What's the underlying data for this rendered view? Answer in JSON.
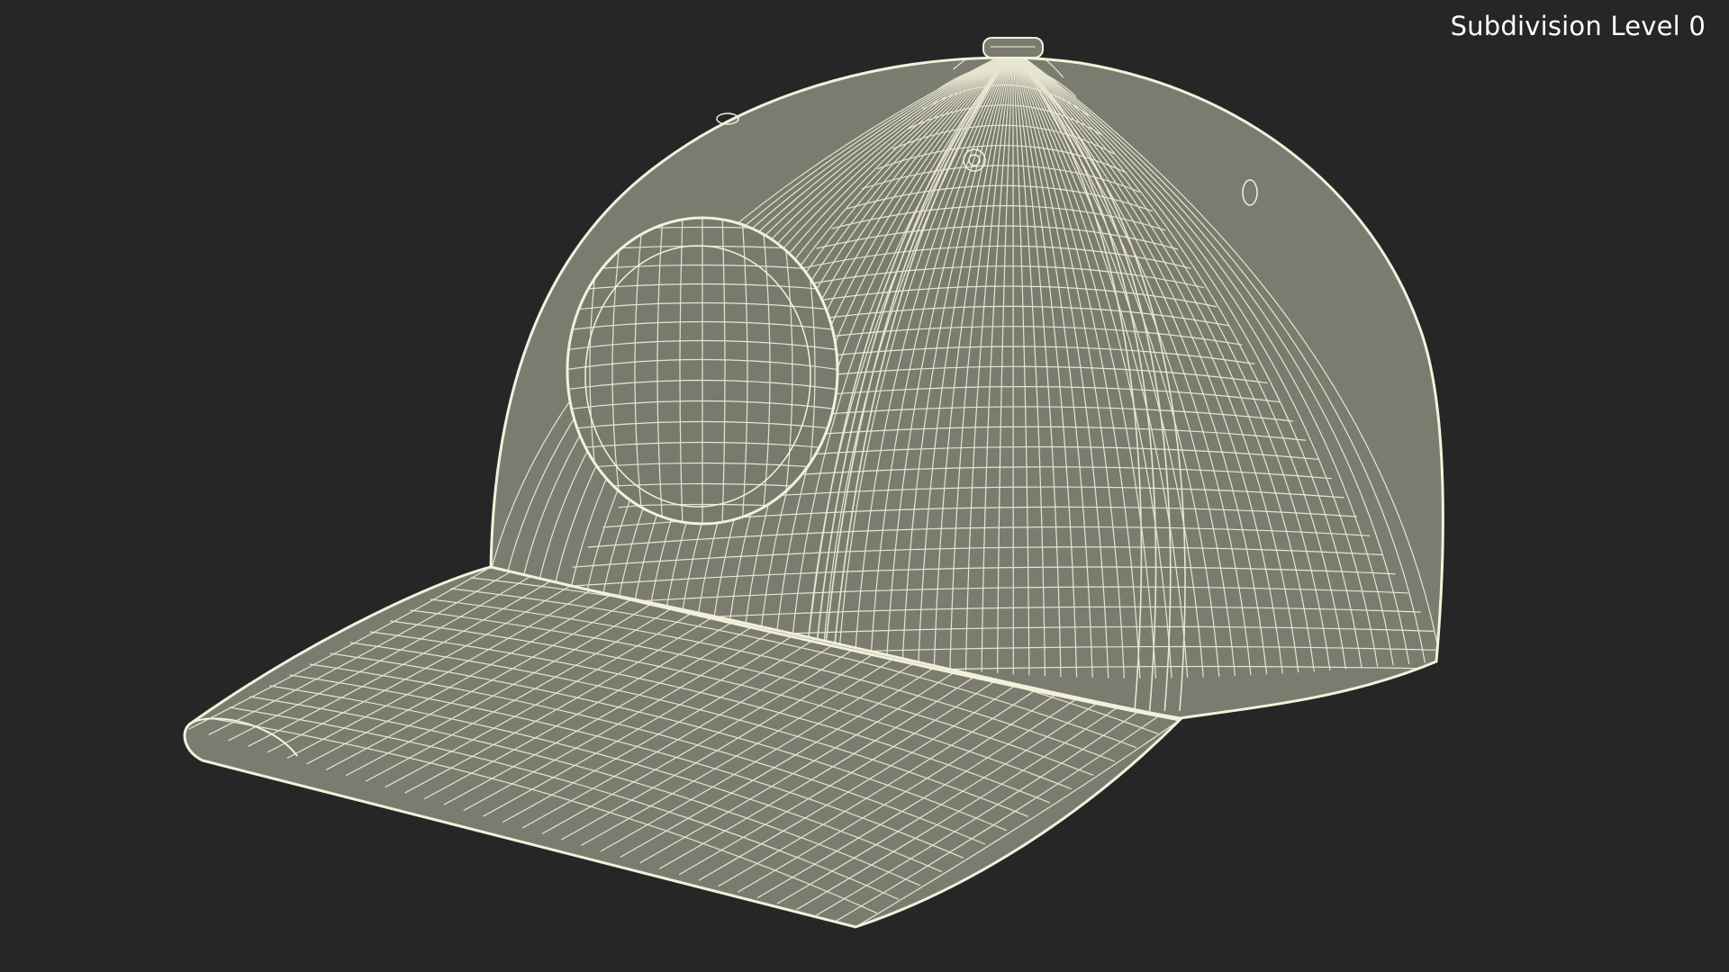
{
  "viewport": {
    "background": "#262626",
    "label": "Subdivision Level 0"
  },
  "model": {
    "surface_color": "#7b7c6f",
    "wire_color": "#f2f1dc"
  }
}
